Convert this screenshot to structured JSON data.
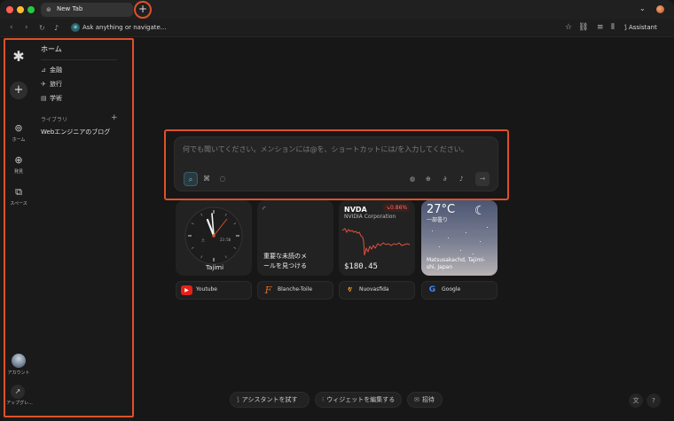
{
  "tabbar": {
    "tab_title": "New Tab",
    "new_tab_label": "+"
  },
  "addressbar": {
    "address_text": "Ask anything or navigate...",
    "assistant_label": "Assistant"
  },
  "sidebar": {
    "rail": [
      {
        "label": "ホーム",
        "icon": "home-search-icon"
      },
      {
        "label": "発見",
        "icon": "globe-icon"
      },
      {
        "label": "スペース",
        "icon": "spaces-icon"
      }
    ],
    "account_label": "アカウント",
    "upgrade_label": "アップグレ..."
  },
  "panel": {
    "title": "ホーム",
    "items": [
      {
        "label": "金融",
        "icon": "chart-icon"
      },
      {
        "label": "旅行",
        "icon": "plane-icon"
      },
      {
        "label": "学術",
        "icon": "book-icon"
      }
    ],
    "library_title": "ライブラリ",
    "library_items": [
      "Webエンジニアのブログ"
    ]
  },
  "search": {
    "placeholder": "何でも聞いてください。メンションには@を、ショートカットには/を入力してください。"
  },
  "widgets": {
    "clock": {
      "city": "Tajimi",
      "digital": "23:50",
      "day": "土"
    },
    "mail": {
      "text_line1": "重要な未読のメ",
      "text_line2": "ールを見つける"
    },
    "stock": {
      "ticker": "NVDA",
      "company": "NVIDIA Corporation",
      "change": "↘0.86%",
      "price": "$180.45"
    },
    "weather": {
      "temp": "27°C",
      "condition": "一部曇り",
      "location_line1": "Matsusakachd, Tajimi-",
      "location_line2": "shi, Japan"
    }
  },
  "shortcuts": [
    {
      "label": "Youtube",
      "icon": "youtube-icon",
      "color": "#e62117"
    },
    {
      "label": "Blanche-Toile",
      "icon": "letter-f-icon",
      "color": "#e06c2a"
    },
    {
      "label": "Nuovasfida",
      "icon": "flame-icon",
      "color": "#f0a020"
    },
    {
      "label": "Google",
      "icon": "google-icon",
      "color": "#4285f4"
    }
  ],
  "bottombar": {
    "try_assistant": "アシスタントを試す",
    "edit_widgets": "ウィジェットを編集する",
    "invite": "招待"
  },
  "colors": {
    "highlight": "#e0502a",
    "stock_line": "#e0513f",
    "accent": "#6dc5d8"
  }
}
